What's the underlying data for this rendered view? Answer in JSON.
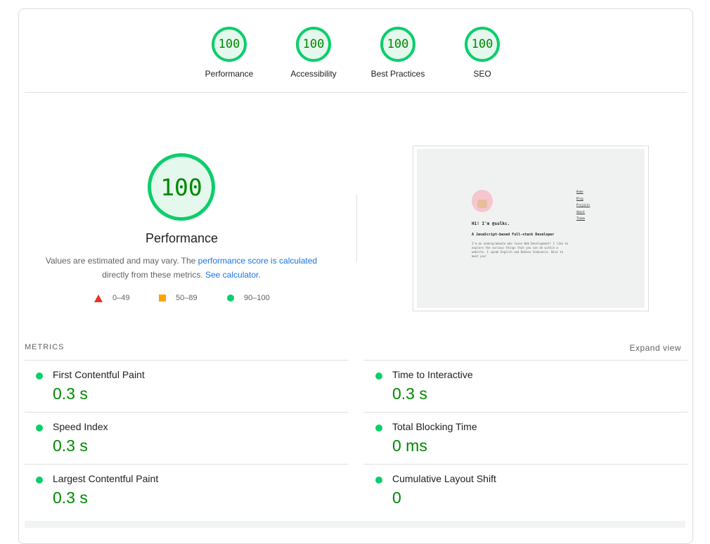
{
  "summary_gauges": [
    {
      "score": "100",
      "label": "Performance"
    },
    {
      "score": "100",
      "label": "Accessibility"
    },
    {
      "score": "100",
      "label": "Best Practices"
    },
    {
      "score": "100",
      "label": "SEO"
    }
  ],
  "performance": {
    "score": "100",
    "title": "Performance",
    "desc_part1": "Values are estimated and may vary. The ",
    "desc_link1": "performance score is calculated",
    "desc_part2": "directly from these metrics.",
    "desc_link2": "See calculator."
  },
  "legend": [
    {
      "shape": "triangle",
      "range": "0–49",
      "color": "#eb3223"
    },
    {
      "shape": "square",
      "range": "50–89",
      "color": "#ffa400"
    },
    {
      "shape": "circle",
      "range": "90–100",
      "color": "#0cce6b"
    }
  ],
  "thumbnail": {
    "greeting": "Hi! I'm @sulkc.",
    "subtitle": "A JavaScript-based Full-stack Developer",
    "intro": "I'm an undergraduate who loves Web Development! I like to explore the various things that you can do within a website. I speak English and Bahasa Indonesia. Nice to meet you!",
    "nav": [
      "Home",
      "Blog",
      "Projects",
      "About",
      "Theme"
    ]
  },
  "metrics": {
    "header": "METRICS",
    "expand_label": "Expand view",
    "items": [
      {
        "title": "First Contentful Paint",
        "value": "0.3 s"
      },
      {
        "title": "Time to Interactive",
        "value": "0.3 s"
      },
      {
        "title": "Speed Index",
        "value": "0.3 s"
      },
      {
        "title": "Total Blocking Time",
        "value": "0 ms"
      },
      {
        "title": "Largest Contentful Paint",
        "value": "0.3 s"
      },
      {
        "title": "Cumulative Layout Shift",
        "value": "0"
      }
    ]
  },
  "colors": {
    "pass": "#0cce6b",
    "pass_text": "#008800",
    "link": "#1a73e8"
  }
}
